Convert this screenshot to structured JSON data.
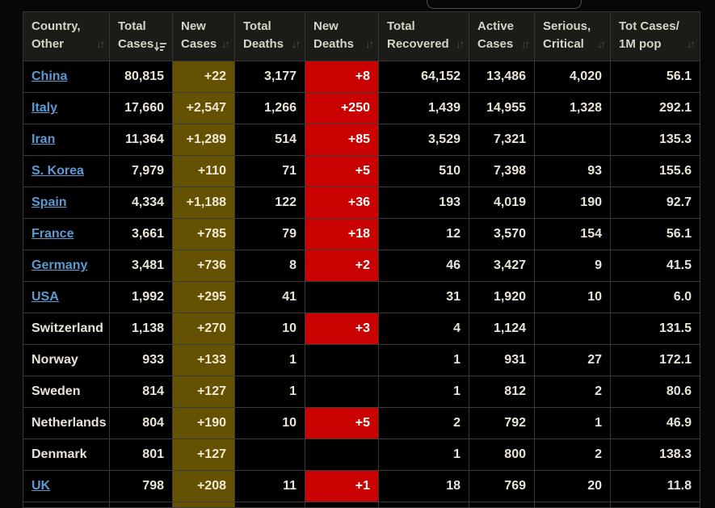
{
  "colors": {
    "new_cases_highlight": "#655102",
    "new_deaths_highlight": "#c90101",
    "link_blue": "#5c9bd2",
    "header_bg": "#1b1b18",
    "cell_bg": "#000000"
  },
  "table": {
    "columns": [
      {
        "line1": "Country,",
        "line2": "Other",
        "sort": "inactive"
      },
      {
        "line1": "Total",
        "line2": "Cases",
        "sort": "active-desc"
      },
      {
        "line1": "New",
        "line2": "Cases",
        "sort": "inactive"
      },
      {
        "line1": "Total",
        "line2": "Deaths",
        "sort": "inactive"
      },
      {
        "line1": "New",
        "line2": "Deaths",
        "sort": "inactive"
      },
      {
        "line1": "Total",
        "line2": "Recovered",
        "sort": "inactive"
      },
      {
        "line1": "Active",
        "line2": "Cases",
        "sort": "inactive"
      },
      {
        "line1": "Serious,",
        "line2": "Critical",
        "sort": "inactive"
      },
      {
        "line1": "Tot Cases/",
        "line2": "1M pop",
        "sort": "inactive"
      }
    ],
    "rows": [
      {
        "country": "China",
        "is_link": true,
        "total_cases": "80,815",
        "new_cases": "+22",
        "total_deaths": "3,177",
        "new_deaths": "+8",
        "total_recovered": "64,152",
        "active_cases": "13,486",
        "serious_critical": "4,020",
        "cases_per_1m": "56.1"
      },
      {
        "country": "Italy",
        "is_link": true,
        "total_cases": "17,660",
        "new_cases": "+2,547",
        "total_deaths": "1,266",
        "new_deaths": "+250",
        "total_recovered": "1,439",
        "active_cases": "14,955",
        "serious_critical": "1,328",
        "cases_per_1m": "292.1"
      },
      {
        "country": "Iran",
        "is_link": true,
        "total_cases": "11,364",
        "new_cases": "+1,289",
        "total_deaths": "514",
        "new_deaths": "+85",
        "total_recovered": "3,529",
        "active_cases": "7,321",
        "serious_critical": "",
        "cases_per_1m": "135.3"
      },
      {
        "country": "S. Korea",
        "is_link": true,
        "total_cases": "7,979",
        "new_cases": "+110",
        "total_deaths": "71",
        "new_deaths": "+5",
        "total_recovered": "510",
        "active_cases": "7,398",
        "serious_critical": "93",
        "cases_per_1m": "155.6"
      },
      {
        "country": "Spain",
        "is_link": true,
        "total_cases": "4,334",
        "new_cases": "+1,188",
        "total_deaths": "122",
        "new_deaths": "+36",
        "total_recovered": "193",
        "active_cases": "4,019",
        "serious_critical": "190",
        "cases_per_1m": "92.7"
      },
      {
        "country": "France",
        "is_link": true,
        "total_cases": "3,661",
        "new_cases": "+785",
        "total_deaths": "79",
        "new_deaths": "+18",
        "total_recovered": "12",
        "active_cases": "3,570",
        "serious_critical": "154",
        "cases_per_1m": "56.1"
      },
      {
        "country": "Germany",
        "is_link": true,
        "total_cases": "3,481",
        "new_cases": "+736",
        "total_deaths": "8",
        "new_deaths": "+2",
        "total_recovered": "46",
        "active_cases": "3,427",
        "serious_critical": "9",
        "cases_per_1m": "41.5"
      },
      {
        "country": "USA",
        "is_link": true,
        "total_cases": "1,992",
        "new_cases": "+295",
        "total_deaths": "41",
        "new_deaths": "",
        "total_recovered": "31",
        "active_cases": "1,920",
        "serious_critical": "10",
        "cases_per_1m": "6.0"
      },
      {
        "country": "Switzerland",
        "is_link": false,
        "total_cases": "1,138",
        "new_cases": "+270",
        "total_deaths": "10",
        "new_deaths": "+3",
        "total_recovered": "4",
        "active_cases": "1,124",
        "serious_critical": "",
        "cases_per_1m": "131.5"
      },
      {
        "country": "Norway",
        "is_link": false,
        "total_cases": "933",
        "new_cases": "+133",
        "total_deaths": "1",
        "new_deaths": "",
        "total_recovered": "1",
        "active_cases": "931",
        "serious_critical": "27",
        "cases_per_1m": "172.1"
      },
      {
        "country": "Sweden",
        "is_link": false,
        "total_cases": "814",
        "new_cases": "+127",
        "total_deaths": "1",
        "new_deaths": "",
        "total_recovered": "1",
        "active_cases": "812",
        "serious_critical": "2",
        "cases_per_1m": "80.6"
      },
      {
        "country": "Netherlands",
        "is_link": false,
        "total_cases": "804",
        "new_cases": "+190",
        "total_deaths": "10",
        "new_deaths": "+5",
        "total_recovered": "2",
        "active_cases": "792",
        "serious_critical": "1",
        "cases_per_1m": "46.9"
      },
      {
        "country": "Denmark",
        "is_link": false,
        "total_cases": "801",
        "new_cases": "+127",
        "total_deaths": "",
        "new_deaths": "",
        "total_recovered": "1",
        "active_cases": "800",
        "serious_critical": "2",
        "cases_per_1m": "138.3"
      },
      {
        "country": "UK",
        "is_link": true,
        "total_cases": "798",
        "new_cases": "+208",
        "total_deaths": "11",
        "new_deaths": "+1",
        "total_recovered": "18",
        "active_cases": "769",
        "serious_critical": "20",
        "cases_per_1m": "11.8"
      }
    ],
    "sort_icon_inactive": "↓↑"
  }
}
